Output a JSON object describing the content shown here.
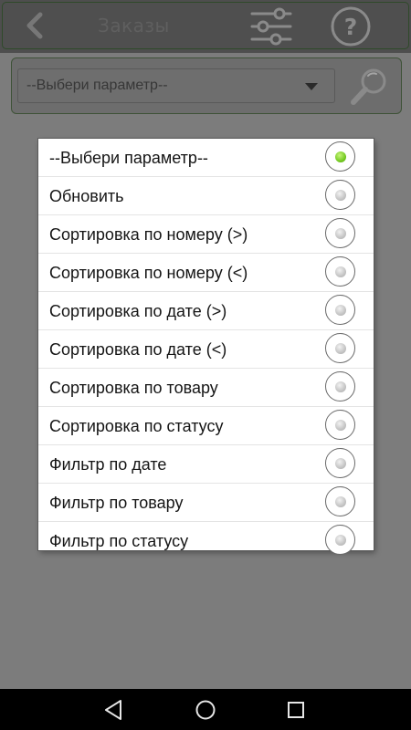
{
  "topbar": {
    "title": "Заказы",
    "back_icon": "chevron-left-icon",
    "filter_icon": "sliders-icon",
    "help_icon": "question-circle-icon",
    "help_glyph": "?"
  },
  "search": {
    "selected_value": "--Выбери параметр--",
    "search_icon": "magnifier-icon"
  },
  "dialog": {
    "options": [
      {
        "label": "--Выбери параметр--",
        "selected": true
      },
      {
        "label": "Обновить",
        "selected": false
      },
      {
        "label": "Сортировка по номеру (>)",
        "selected": false
      },
      {
        "label": "Сортировка по номеру (<)",
        "selected": false
      },
      {
        "label": "Сортировка по дате (>)",
        "selected": false
      },
      {
        "label": "Сортировка по дате (<)",
        "selected": false
      },
      {
        "label": "Сортировка по товару",
        "selected": false
      },
      {
        "label": "Сортировка по статусу",
        "selected": false
      },
      {
        "label": "Фильтр по дате",
        "selected": false
      },
      {
        "label": "Фильтр по товару",
        "selected": false
      },
      {
        "label": "Фильтр по статусу",
        "selected": false
      }
    ]
  },
  "navbar": {
    "back_icon": "nav-back-icon",
    "home_icon": "nav-home-icon",
    "recents_icon": "nav-recents-icon"
  },
  "colors": {
    "accent_selected": "#6fc61c",
    "frame_green": "#2f4a2a",
    "background": "#7c7c7c"
  }
}
